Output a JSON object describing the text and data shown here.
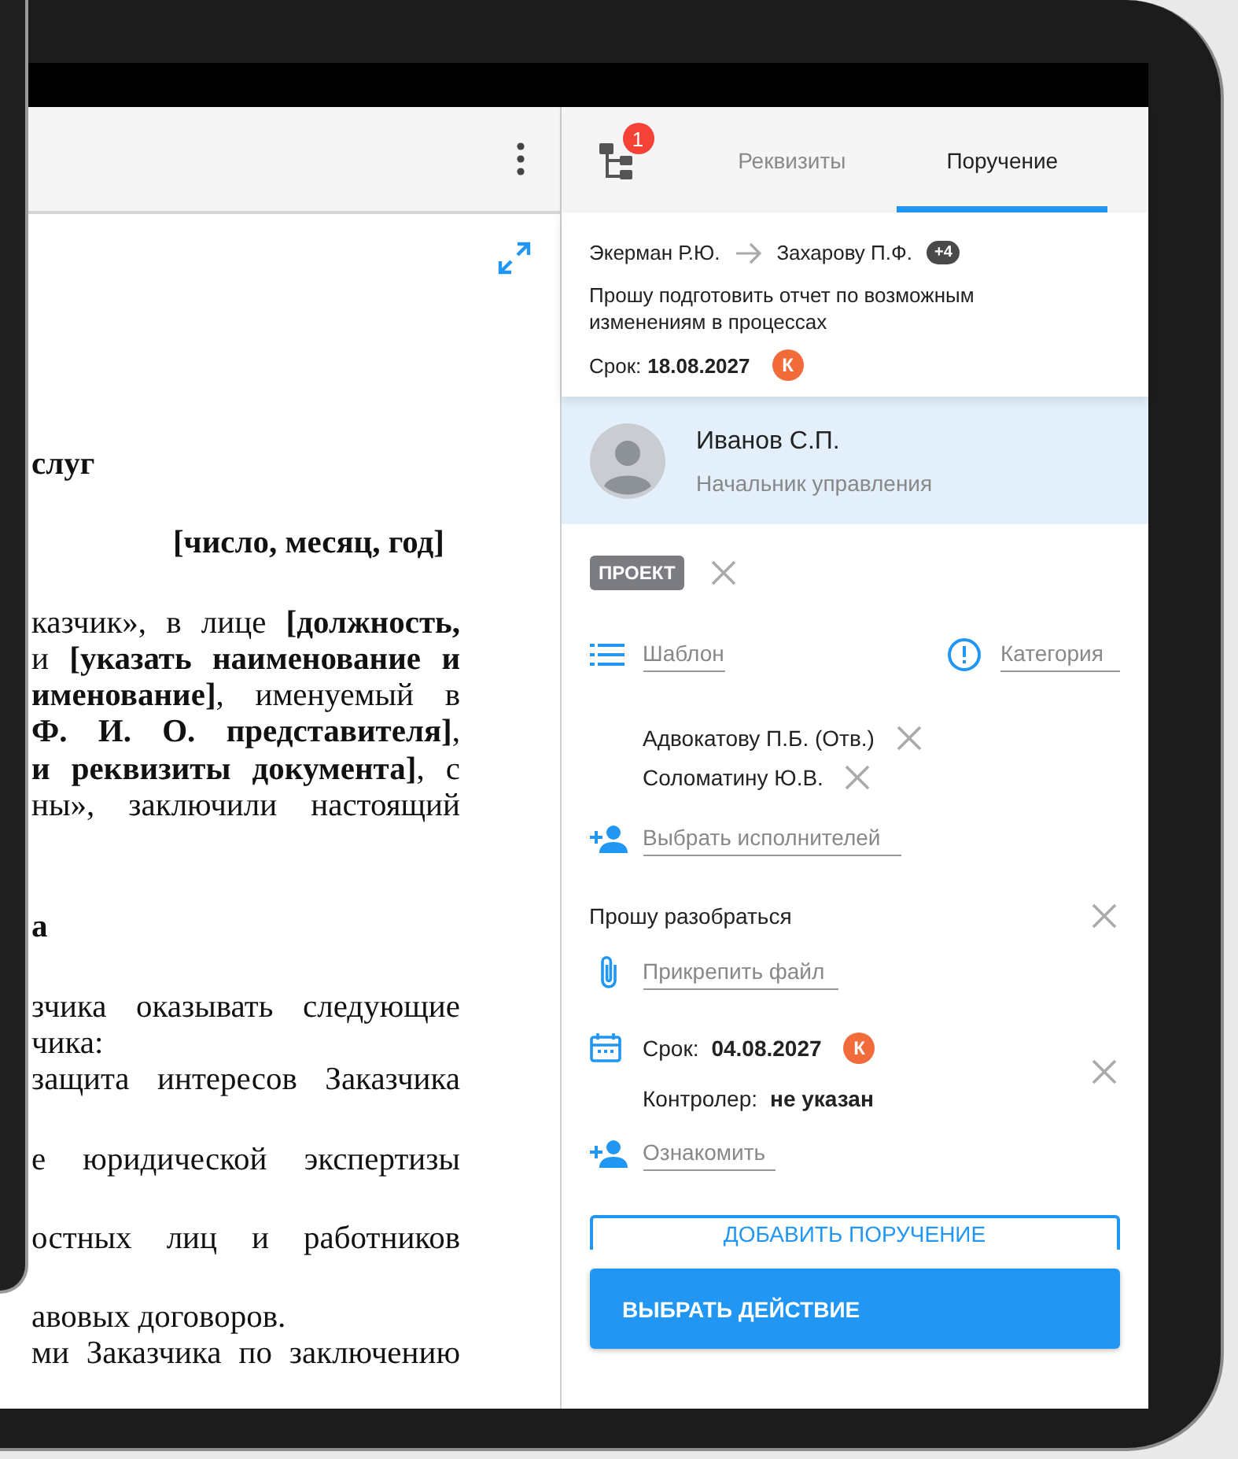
{
  "document": {
    "paragraphs": [
      {
        "kind": "heading",
        "lines": [
          {
            "kind": "short",
            "text": "слуг"
          }
        ]
      },
      {
        "kind": "date",
        "lines": [
          {
            "kind": "short",
            "text": "[число, месяц, год]"
          }
        ]
      },
      {
        "kind": "body",
        "lines": [
          {
            "kind": "justified",
            "text": "казчик», в лице **[должность,**"
          },
          {
            "kind": "justified",
            "text": "и **[указать наименование и**"
          },
          {
            "kind": "justified",
            "text": "**именование]**, именуемый в"
          },
          {
            "kind": "justified",
            "text": "**Ф. И. О. представителя]**,"
          },
          {
            "kind": "justified",
            "text": "**и реквизиты документа]**, с"
          },
          {
            "kind": "justified",
            "text": "ны», заключили настоящий"
          }
        ]
      },
      {
        "kind": "heading",
        "lines": [
          {
            "kind": "short",
            "text": "а"
          }
        ]
      },
      {
        "kind": "body",
        "lines": [
          {
            "kind": "justified",
            "text": "зчика оказывать следующие"
          },
          {
            "kind": "short",
            "text": "чика:"
          },
          {
            "kind": "justified",
            "text": "защита интересов Заказчика"
          }
        ]
      },
      {
        "kind": "body",
        "lines": [
          {
            "kind": "justified",
            "text": "е юридической экспертизы"
          }
        ]
      },
      {
        "kind": "body",
        "lines": [
          {
            "kind": "justified",
            "text": "остных лиц и работников"
          }
        ]
      },
      {
        "kind": "body",
        "lines": [
          {
            "kind": "short",
            "text": "авовых договоров."
          },
          {
            "kind": "justified",
            "text": "ми Заказчика по заключению"
          }
        ]
      }
    ]
  },
  "panel": {
    "badge": "1",
    "tabs": [
      {
        "label": "Реквизиты",
        "selected": false
      },
      {
        "label": "Поручение",
        "selected": true
      }
    ]
  },
  "order": {
    "from": "Экерман Р.Ю.",
    "to": "Захарову П.Ф.",
    "more": "+4",
    "text": "Прошу подготовить отчет по возможным изменениям в процессах",
    "due_label": "Срок:",
    "due_date": "18.08.2027",
    "control_mark": "К"
  },
  "person": {
    "name": "Иванов С.П.",
    "position": "Начальник управления"
  },
  "status_chip": "ПРОЕКТ",
  "template": {
    "placeholder": "Шаблон"
  },
  "category": {
    "placeholder": "Категория"
  },
  "executors": [
    {
      "name": "Адвокатову П.Б. (Отв.)"
    },
    {
      "name": "Соломатину Ю.В."
    }
  ],
  "executors_field": {
    "placeholder": "Выбрать исполнителей"
  },
  "comment": {
    "value": "Прошу разобраться"
  },
  "attachment": {
    "placeholder": "Прикрепить файл"
  },
  "deadline": {
    "label": "Срок:",
    "date": "04.08.2027",
    "control_mark": "К",
    "controller_label": "Контролер:",
    "controller": "не указан"
  },
  "acquaint": {
    "placeholder": "Ознакомить"
  },
  "buttons": {
    "add": "ДОБАВИТЬ ПОРУЧЕНИЕ",
    "action": "ВЫБРАТЬ ДЕЙСТВИЕ"
  }
}
